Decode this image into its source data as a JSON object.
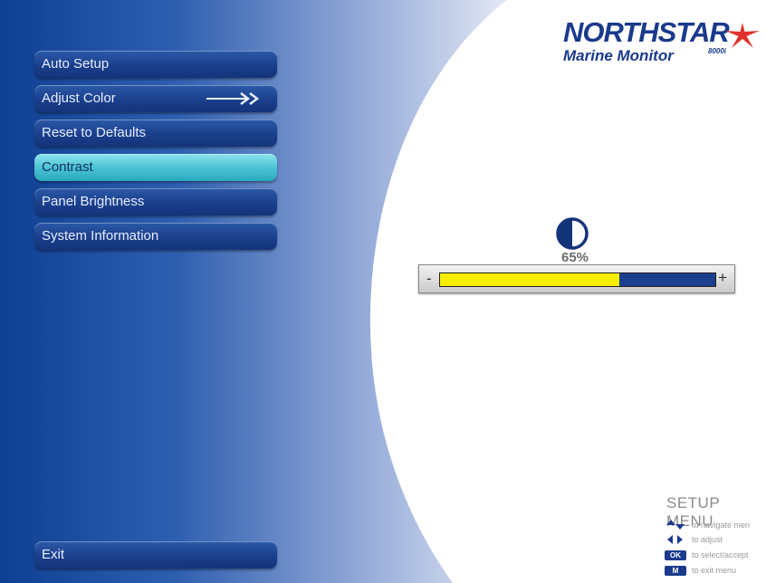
{
  "menu": {
    "items": [
      {
        "label": "Auto Setup",
        "active": false
      },
      {
        "label": "Adjust Color",
        "active": false,
        "has_arrow": true
      },
      {
        "label": "Reset to Defaults",
        "active": false
      },
      {
        "label": "Contrast",
        "active": true
      },
      {
        "label": "Panel Brightness",
        "active": false
      },
      {
        "label": "System Information",
        "active": false
      }
    ],
    "exit_label": "Exit"
  },
  "logo": {
    "brand": "NORTHSTAR",
    "subtitle": "Marine Monitor",
    "model": "8000i"
  },
  "contrast": {
    "value_label": "65%",
    "value": 0.65,
    "minus_label": "-",
    "plus_label": "+"
  },
  "help": {
    "title": "SETUP MENU",
    "rows": [
      {
        "key": "up-down-arrows",
        "text": "to navigate men"
      },
      {
        "key": "left-right-arrows",
        "text": "to adjust"
      },
      {
        "key": "OK",
        "text": "to select/accept"
      },
      {
        "key": "M",
        "text": "to exit menu"
      }
    ]
  },
  "colors": {
    "menu_button": "#1b3f8c",
    "menu_active": "#4cc3d4",
    "slider_fill": "#f5ee00",
    "slider_track": "#1a3f8e",
    "brand": "#1b3a8c",
    "star": "#e0322c"
  }
}
